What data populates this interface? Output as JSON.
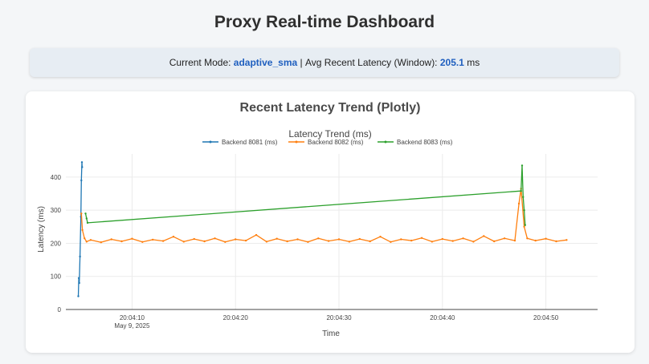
{
  "header": {
    "title": "Proxy Real-time Dashboard"
  },
  "status": {
    "mode_label": "Current Mode:",
    "mode_value": "adaptive_sma",
    "separator": "|",
    "latency_label": "Avg Recent Latency (Window):",
    "latency_value": "205.1",
    "unit": "ms"
  },
  "card": {
    "title": "Recent Latency Trend (Plotly)"
  },
  "chart_data": {
    "type": "line",
    "title": "Latency Trend (ms)",
    "xlabel": "Time",
    "ylabel": "Latency (ms)",
    "xlim": [
      "20:04:03.6",
      "20:04:55"
    ],
    "ylim": [
      0,
      470
    ],
    "x_ticks": [
      "20:04:10",
      "20:04:20",
      "20:04:30",
      "20:04:40",
      "20:04:50"
    ],
    "x_tick_sublabel": "May 9, 2025",
    "y_ticks": [
      0,
      100,
      200,
      300,
      400
    ],
    "grid": true,
    "legend": "top",
    "series": [
      {
        "name": "Backend 8081 (ms)",
        "color": "#1f77b4",
        "points": [
          [
            "20:04:04.80",
            40
          ],
          [
            "20:04:04.85",
            95
          ],
          [
            "20:04:04.90",
            80
          ],
          [
            "20:04:04.97",
            160
          ],
          [
            "20:04:05.05",
            280
          ],
          [
            "20:04:05.10",
            390
          ],
          [
            "20:04:05.15",
            445
          ],
          [
            "20:04:05.18",
            430
          ]
        ]
      },
      {
        "name": "Backend 8082 (ms)",
        "color": "#ff7f0e",
        "points": [
          [
            "20:04:05.1",
            290
          ],
          [
            "20:04:05.2",
            240
          ],
          [
            "20:04:05.4",
            215
          ],
          [
            "20:04:05.6",
            205
          ],
          [
            "20:04:06",
            210
          ],
          [
            "20:04:07",
            203
          ],
          [
            "20:04:08",
            212
          ],
          [
            "20:04:09",
            206
          ],
          [
            "20:04:10",
            214
          ],
          [
            "20:04:11",
            204
          ],
          [
            "20:04:12",
            211
          ],
          [
            "20:04:13",
            207
          ],
          [
            "20:04:14",
            220
          ],
          [
            "20:04:15",
            205
          ],
          [
            "20:04:16",
            213
          ],
          [
            "20:04:17",
            206
          ],
          [
            "20:04:18",
            215
          ],
          [
            "20:04:19",
            204
          ],
          [
            "20:04:20",
            212
          ],
          [
            "20:04:21",
            208
          ],
          [
            "20:04:22",
            225
          ],
          [
            "20:04:23",
            205
          ],
          [
            "20:04:24",
            214
          ],
          [
            "20:04:25",
            206
          ],
          [
            "20:04:26",
            212
          ],
          [
            "20:04:27",
            204
          ],
          [
            "20:04:28",
            215
          ],
          [
            "20:04:29",
            207
          ],
          [
            "20:04:30",
            212
          ],
          [
            "20:04:31",
            205
          ],
          [
            "20:04:32",
            213
          ],
          [
            "20:04:33",
            206
          ],
          [
            "20:04:34",
            220
          ],
          [
            "20:04:35",
            204
          ],
          [
            "20:04:36",
            212
          ],
          [
            "20:04:37",
            208
          ],
          [
            "20:04:38",
            216
          ],
          [
            "20:04:39",
            205
          ],
          [
            "20:04:40",
            213
          ],
          [
            "20:04:41",
            207
          ],
          [
            "20:04:42",
            215
          ],
          [
            "20:04:43",
            205
          ],
          [
            "20:04:44",
            222
          ],
          [
            "20:04:45",
            206
          ],
          [
            "20:04:46",
            215
          ],
          [
            "20:04:47",
            208
          ],
          [
            "20:04:47.4",
            320
          ],
          [
            "20:04:47.6",
            365
          ],
          [
            "20:04:47.9",
            250
          ],
          [
            "20:04:48.2",
            215
          ],
          [
            "20:04:49",
            208
          ],
          [
            "20:04:50",
            214
          ],
          [
            "20:04:51",
            206
          ],
          [
            "20:04:52",
            210
          ]
        ]
      },
      {
        "name": "Backend 8083 (ms)",
        "color": "#2ca02c",
        "points": [
          [
            "20:04:05.5",
            290
          ],
          [
            "20:04:05.6",
            275
          ],
          [
            "20:04:05.7",
            262
          ],
          [
            "20:04:47.6",
            358
          ],
          [
            "20:04:47.7",
            435
          ],
          [
            "20:04:47.8",
            340
          ],
          [
            "20:04:47.9",
            300
          ],
          [
            "20:04:48.0",
            255
          ]
        ]
      }
    ]
  }
}
